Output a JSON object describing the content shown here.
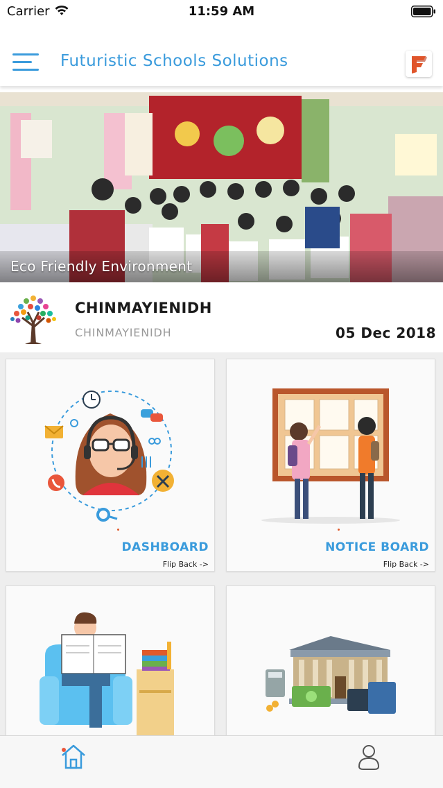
{
  "status_bar": {
    "carrier": "Carrier",
    "time": "11:59 AM"
  },
  "header": {
    "title": "Futuristic Schools Solutions",
    "menu_icon": "hamburger-menu-icon",
    "logo_icon": "school-logo-icon"
  },
  "banner": {
    "caption": "Eco Friendly Environment"
  },
  "profile": {
    "name": "CHINMAYIENIDH",
    "subtitle": "CHINMAYIENIDH",
    "date": "05 Dec 2018"
  },
  "cards": [
    {
      "label": "DASHBOARD",
      "flip": "Flip Back ->"
    },
    {
      "label": "NOTICE BOARD",
      "flip": "Flip Back ->"
    },
    {
      "label": "",
      "flip": ""
    },
    {
      "label": "",
      "flip": ""
    }
  ],
  "tabbar": {
    "home_icon": "home-icon",
    "profile_icon": "user-profile-icon"
  },
  "colors": {
    "accent": "#3a9bdc",
    "tabbar_bg": "#f7f7f7",
    "grid_bg": "#eeeeee"
  }
}
